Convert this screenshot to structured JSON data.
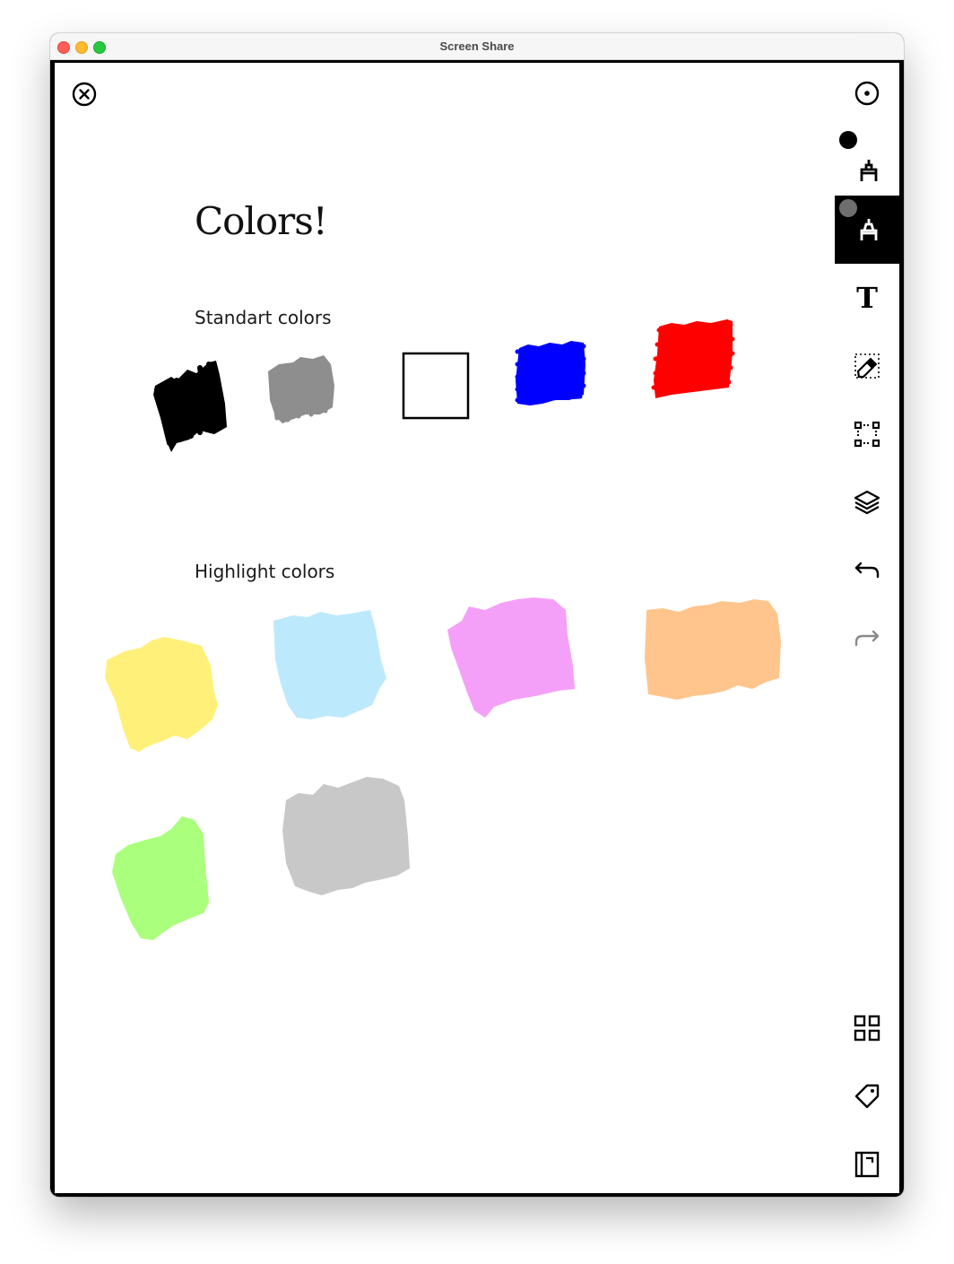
{
  "window": {
    "title": "Screen Share"
  },
  "page": {
    "title": "Colors!",
    "sections": {
      "standard": {
        "label": "Standart colors"
      },
      "highlight": {
        "label": "Highlight colors"
      }
    }
  },
  "colors": {
    "standard": [
      {
        "name": "black",
        "hex": "#000000",
        "style": "scribble"
      },
      {
        "name": "gray",
        "hex": "#8e8e8e",
        "style": "scribble"
      },
      {
        "name": "white",
        "hex": "#ffffff",
        "style": "outlined-square"
      },
      {
        "name": "blue",
        "hex": "#0000ff",
        "style": "scribble"
      },
      {
        "name": "red",
        "hex": "#ff0000",
        "style": "scribble"
      }
    ],
    "highlight": [
      {
        "name": "yellow",
        "hex": "#fff07a"
      },
      {
        "name": "light-blue",
        "hex": "#bde9fc"
      },
      {
        "name": "pink",
        "hex": "#f5a0f8"
      },
      {
        "name": "orange",
        "hex": "#ffc58c"
      },
      {
        "name": "green",
        "hex": "#aaff7d"
      },
      {
        "name": "silver",
        "hex": "#c8c8c8"
      }
    ]
  },
  "toolbar": {
    "tools": [
      {
        "id": "pointer",
        "icon": "pointer-circle-icon",
        "active": false
      },
      {
        "id": "pen",
        "icon": "pen-icon",
        "active": false,
        "color_dot": "#000000"
      },
      {
        "id": "highlighter",
        "icon": "highlighter-icon",
        "active": true,
        "color_dot": "#6e6e6e"
      },
      {
        "id": "text",
        "icon": "text-tool-icon",
        "active": false
      },
      {
        "id": "eraser",
        "icon": "eraser-icon",
        "active": false
      },
      {
        "id": "select",
        "icon": "selection-icon",
        "active": false
      },
      {
        "id": "layers",
        "icon": "layers-icon",
        "active": false
      },
      {
        "id": "undo",
        "icon": "undo-icon",
        "active": false
      },
      {
        "id": "redo",
        "icon": "redo-icon",
        "active": false,
        "disabled": true
      },
      {
        "id": "grid",
        "icon": "grid-icon",
        "active": false
      },
      {
        "id": "tag",
        "icon": "tag-icon",
        "active": false
      },
      {
        "id": "notebook",
        "icon": "notebook-icon",
        "active": false
      }
    ],
    "text_tool_glyph": "T"
  }
}
